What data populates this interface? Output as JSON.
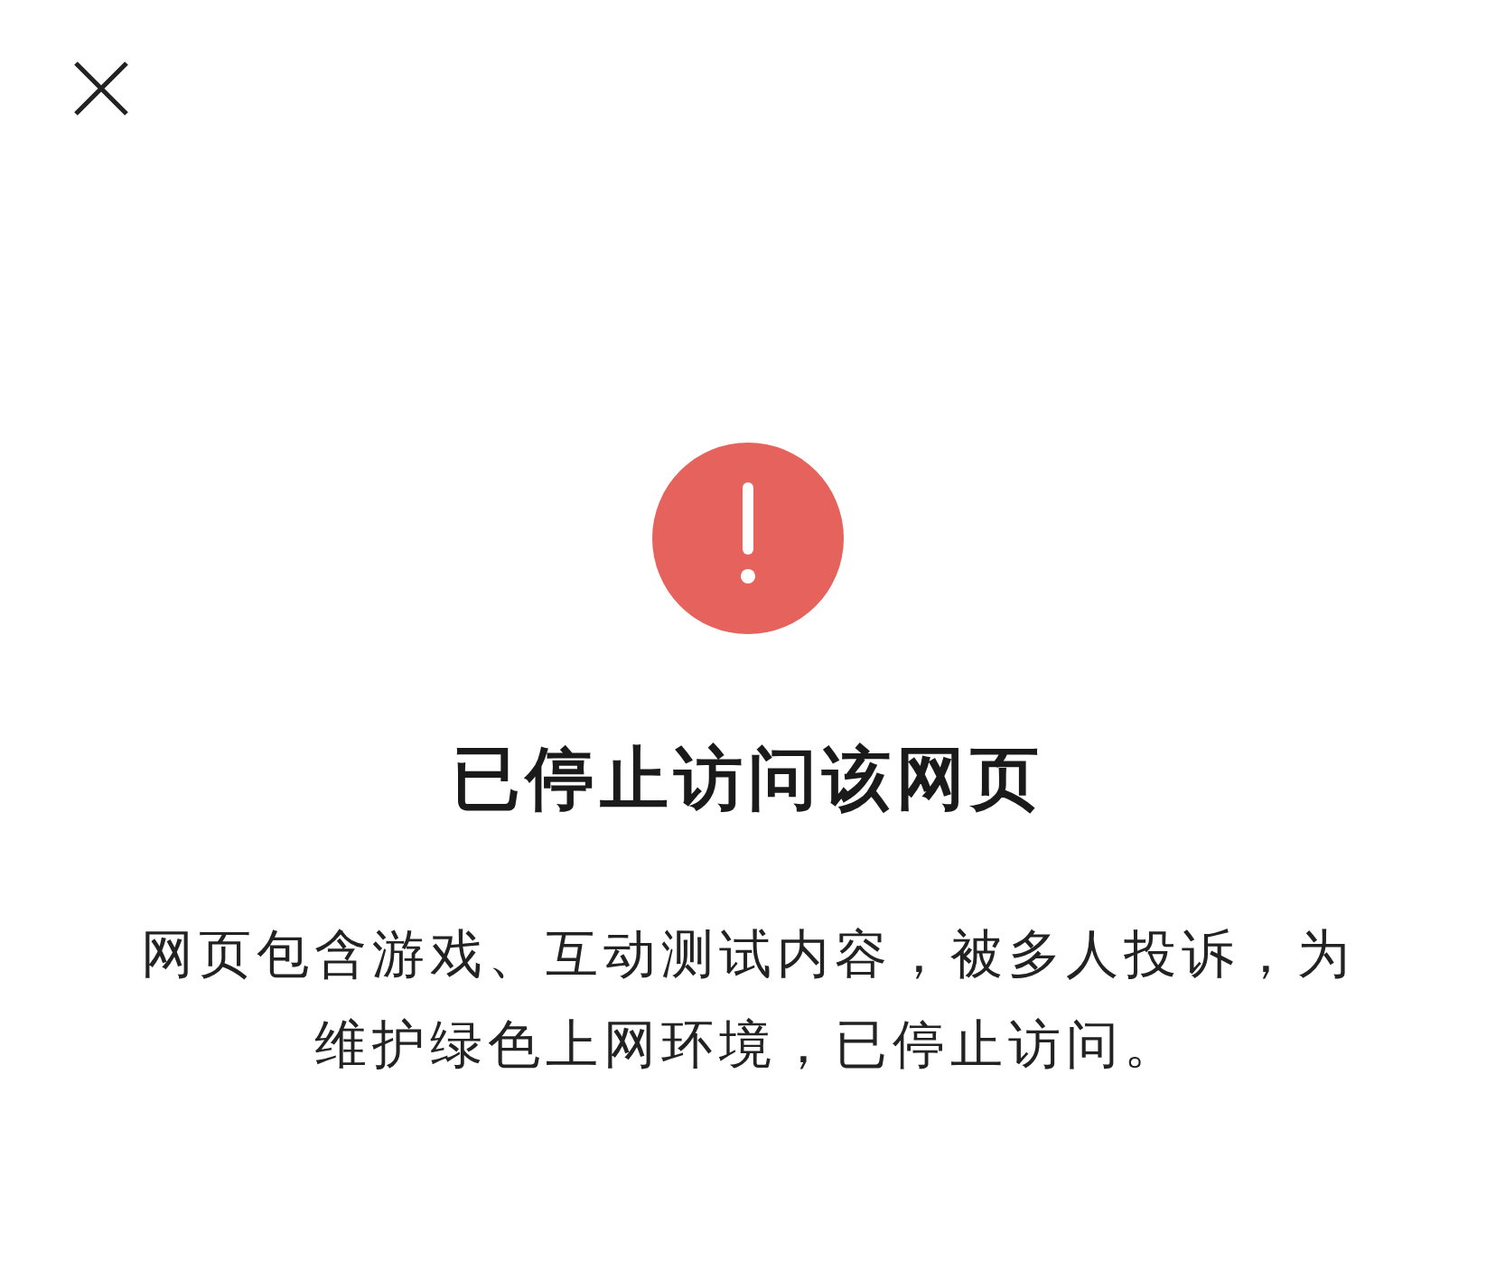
{
  "title": "已停止访问该网页",
  "message": "网页包含游戏、互动测试内容，被多人投诉，为维护绿色上网环境，已停止访问。"
}
